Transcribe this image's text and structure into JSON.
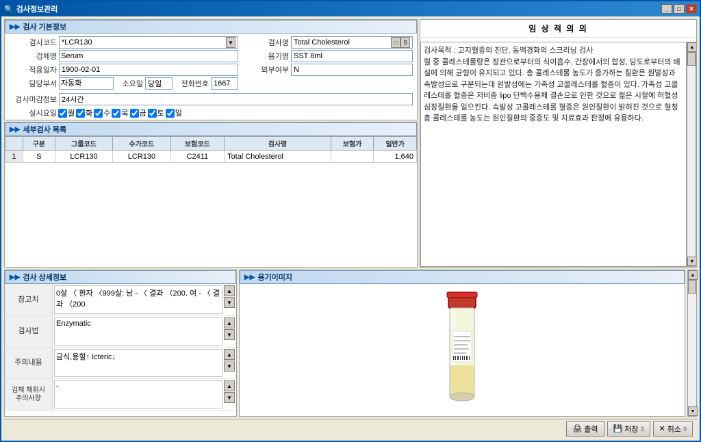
{
  "window": {
    "title": "검사정보관리",
    "icon": "🔍"
  },
  "sections": {
    "basic_info": {
      "title": "검사 기본정보",
      "fields": {
        "exam_code_label": "검사코드",
        "exam_code_value": "*LCR130",
        "exam_name_label": "검사명",
        "exam_name_value": "Total Cholesterol",
        "specimen_label": "검체명",
        "specimen_value": "Serum",
        "container_label": "용기명",
        "container_value": "SST 8ml",
        "applicable_date_label": "적용일자",
        "applicable_date_value": "1900-02-01",
        "external_label": "외부여부",
        "external_value": "N",
        "department_label": "담당부서",
        "department_value": "자동화",
        "weekday_label": "소요일",
        "weekday_value": "당일",
        "phone_label": "전화번호",
        "phone_value": "1667",
        "closing_label": "검사마감정보",
        "closing_value": "24시간",
        "test_day_label": "실시요일",
        "days": [
          "월",
          "화",
          "수",
          "목",
          "금",
          "토",
          "일"
        ]
      }
    },
    "detail_table": {
      "title": "세부검사 목록",
      "headers": [
        "구분",
        "그룹코드",
        "수가코드",
        "보험코드",
        "검사명",
        "보험가",
        "일반가"
      ],
      "rows": [
        {
          "num": "1",
          "type": "S",
          "group_code": "LCR130",
          "suga_code": "LCR130",
          "insurance_code": "C2411",
          "exam_name": "Total Cholesterol",
          "insurance_price": "",
          "general_price": "1,640"
        }
      ]
    },
    "clinical_significance": {
      "title": "임 상 적 의 의",
      "content": "검사목적 : 고지혈증의 진단, 동맥경화의 스크리닝 검사\n혈 중 콜레스테롤량은 장관으로부터의 식이흡수, 간장에서의 합성, 당도로부터의 배설에 의해 균형이 유지되고 있다. 총 콜레스테롤 농도가 증가하는 질환은 원발성과 속발성으로 구분되는데 원발성에는 가족성 고콜레스테롤 혈증이 있다. 가족성 고콜레스테롤 혈증은 저비중 lipo 단백수용체 결손으로 인한 것으로 젊은 시절에 허혈성 심장질환을 일으킨다. 속발성 고콜레스테롤 혈증은 원인질환이 밝혀진 것으로 혈청 총 콜레스테롤 농도는 원인질환의 중증도 및 치료효과 판정에 유용하다."
    },
    "detail_info": {
      "title": "검사 상세정보",
      "reference_label": "참고치",
      "reference_value": "0살 〈 환자 〈999살: 남 - 〈 결과 〈200. 여 - 〈 결과 〈200",
      "method_label": "검사법",
      "method_value": "Enzymatic",
      "caution_label": "주의내용",
      "caution_value": "금식,용혈↑ Icteric↓",
      "collection_label": "검체 채취시\n주의사항",
      "collection_value": "-"
    },
    "container_image": {
      "title": "용기이미지"
    }
  },
  "buttons": {
    "print_label": "출력",
    "save_label": "저장",
    "save_num": "3",
    "close_label": "취소",
    "close_num": "9"
  }
}
